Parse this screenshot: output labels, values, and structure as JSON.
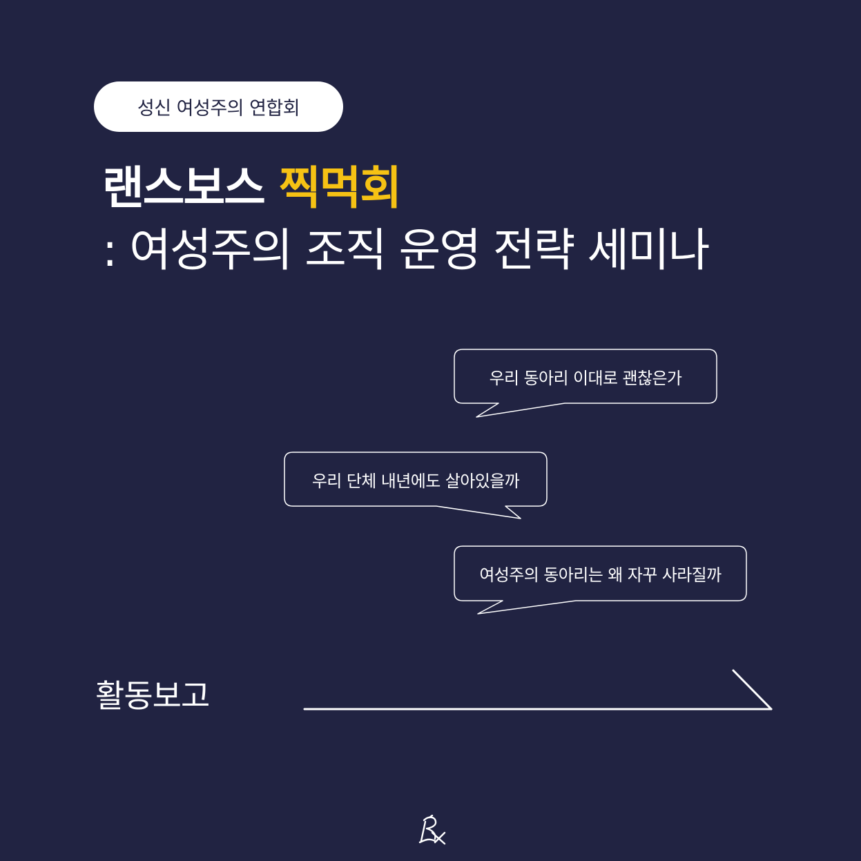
{
  "badge": {
    "label": "성신 여성주의 연합회"
  },
  "title": {
    "line1_white": "랜스보스",
    "line1_accent": "찍먹회",
    "line2": ": 여성주의 조직 운영 전략 세미나"
  },
  "bubbles": [
    {
      "text": "우리 동아리 이대로 괜찮은가"
    },
    {
      "text": "우리 단체 내년에도 살아있을까"
    },
    {
      "text": "여성주의 동아리는 왜 자꾸 사라질까"
    }
  ],
  "footer": {
    "label": "활동보고"
  },
  "colors": {
    "background": "#212342",
    "accent": "#f6c214",
    "text": "#ffffff"
  },
  "icons": {
    "arrow": "arrow-right-line-icon",
    "logo": "dragon-logo-icon"
  }
}
